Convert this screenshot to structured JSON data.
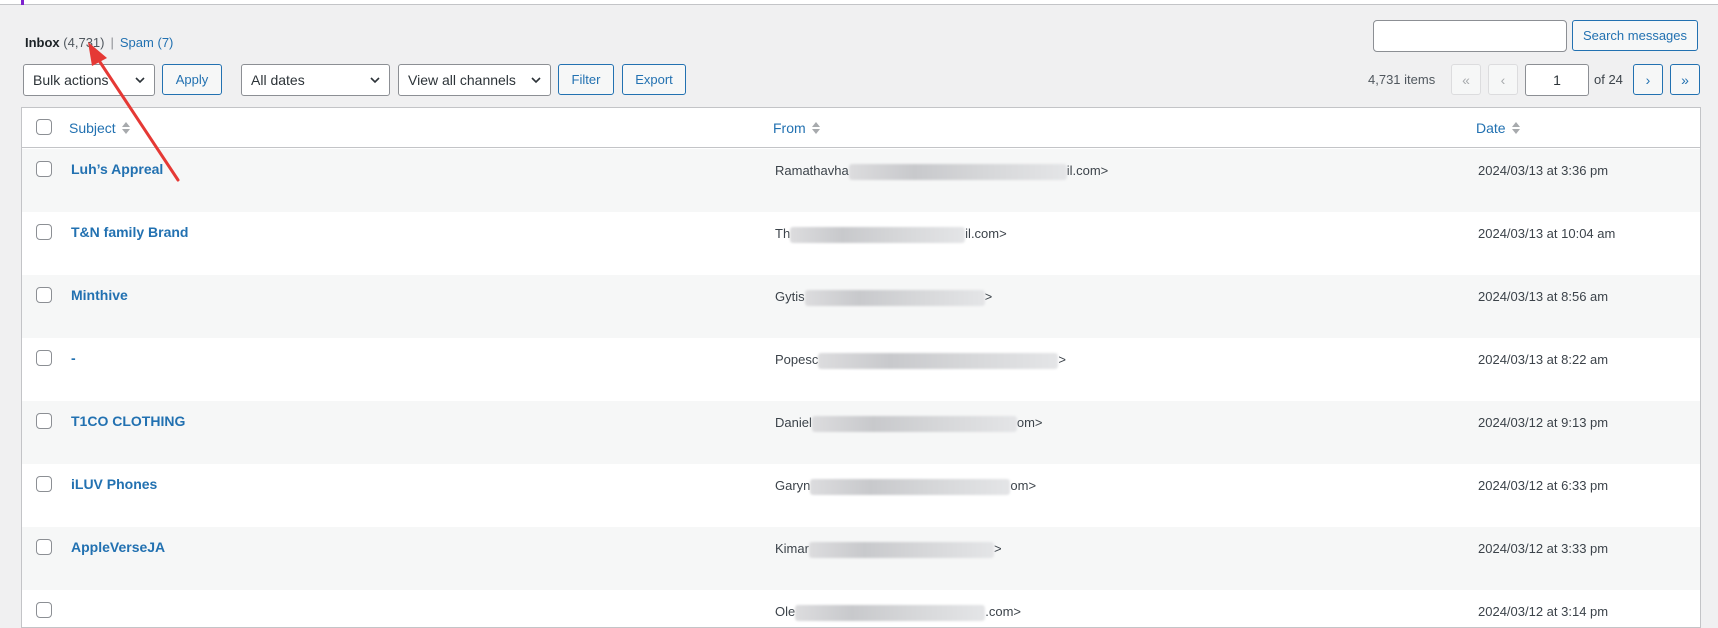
{
  "views": {
    "inbox_label": "Inbox",
    "inbox_count": "(4,731)",
    "separator": "|",
    "spam_label": "Spam",
    "spam_count": "(7)"
  },
  "search": {
    "button_label": "Search messages",
    "value": ""
  },
  "toolbar": {
    "bulk_actions": "Bulk actions",
    "apply_label": "Apply",
    "dates": "All dates",
    "channels": "View all channels",
    "filter_label": "Filter",
    "export_label": "Export"
  },
  "pagination": {
    "items": "4,731 items",
    "first": "«",
    "prev": "‹",
    "current_page": "1",
    "of_pages": "of 24",
    "next": "›",
    "last": "»"
  },
  "table": {
    "columns": {
      "subject": "Subject",
      "from": "From",
      "date": "Date"
    },
    "rows": [
      {
        "subject": "Luh’s Appreal",
        "from_start": "Ramathavha",
        "from_end": "il.com>",
        "date": "2024/03/13 at 3:36 pm"
      },
      {
        "subject": "T&N family Brand",
        "from_start": "Th",
        "from_end": "il.com>",
        "date": "2024/03/13 at 10:04 am"
      },
      {
        "subject": "Minthive",
        "from_start": "Gytis",
        "from_end": ">",
        "date": "2024/03/13 at 8:56 am"
      },
      {
        "subject": "-",
        "from_start": "Popesc",
        "from_end": ">",
        "date": "2024/03/13 at 8:22 am"
      },
      {
        "subject": "T1CO CLOTHING",
        "from_start": "Daniel",
        "from_end": "om>",
        "date": "2024/03/12 at 9:13 pm"
      },
      {
        "subject": "iLUV Phones",
        "from_start": "Garyn",
        "from_end": "om>",
        "date": "2024/03/12 at 6:33 pm"
      },
      {
        "subject": "AppleVerseJA",
        "from_start": "Kimar",
        "from_end": ">",
        "date": "2024/03/12 at 3:33 pm"
      },
      {
        "subject": "",
        "from_start": "Ole",
        "from_end": ".com>",
        "date": "2024/03/12 at 3:14 pm"
      }
    ]
  },
  "colors": {
    "link": "#2271b1",
    "accent": "#7e22ce",
    "annotation_arrow": "#e53935"
  }
}
